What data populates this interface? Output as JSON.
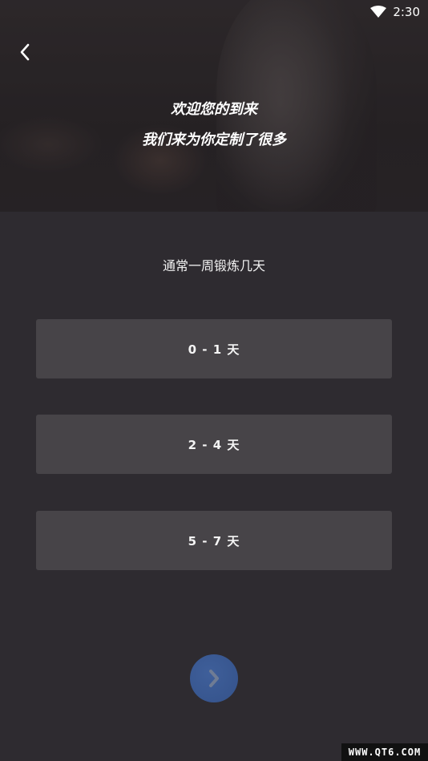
{
  "status_bar": {
    "time": "2:30",
    "wifi_icon": "wifi-icon"
  },
  "header": {
    "back_icon": "chevron-left-icon",
    "welcome_line1": "欢迎您的到来",
    "welcome_line2": "我们来为你定制了很多"
  },
  "question": {
    "text": "通常一周锻炼几天"
  },
  "options": [
    {
      "label": "0 - 1 天"
    },
    {
      "label": "2 - 4 天"
    },
    {
      "label": "5 - 7 天"
    }
  ],
  "next": {
    "icon": "chevron-right-icon"
  },
  "colors": {
    "background": "#2e2b30",
    "option_bg": "#474448",
    "accent": "#3a5a94"
  },
  "watermark": "WWW.QT6.COM"
}
